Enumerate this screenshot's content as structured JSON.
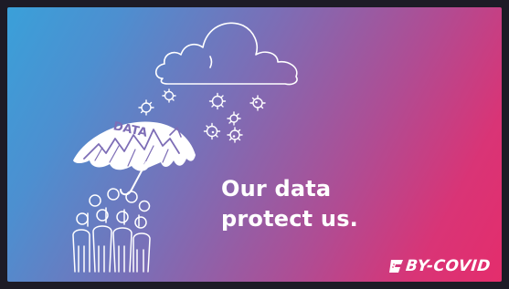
{
  "banner": {
    "headline_line1": "Our data",
    "headline_line2": "protect us.",
    "umbrella_label": "DATA",
    "logo_text": "BY-COVID"
  },
  "colors": {
    "gradient_start": "#3aa0d9",
    "gradient_end": "#e42d6c",
    "text": "#ffffff",
    "frame": "#1d1b26"
  },
  "icons": [
    "cloud-icon",
    "virus-icon",
    "umbrella-icon",
    "people-group-icon",
    "logo-mark-icon"
  ]
}
